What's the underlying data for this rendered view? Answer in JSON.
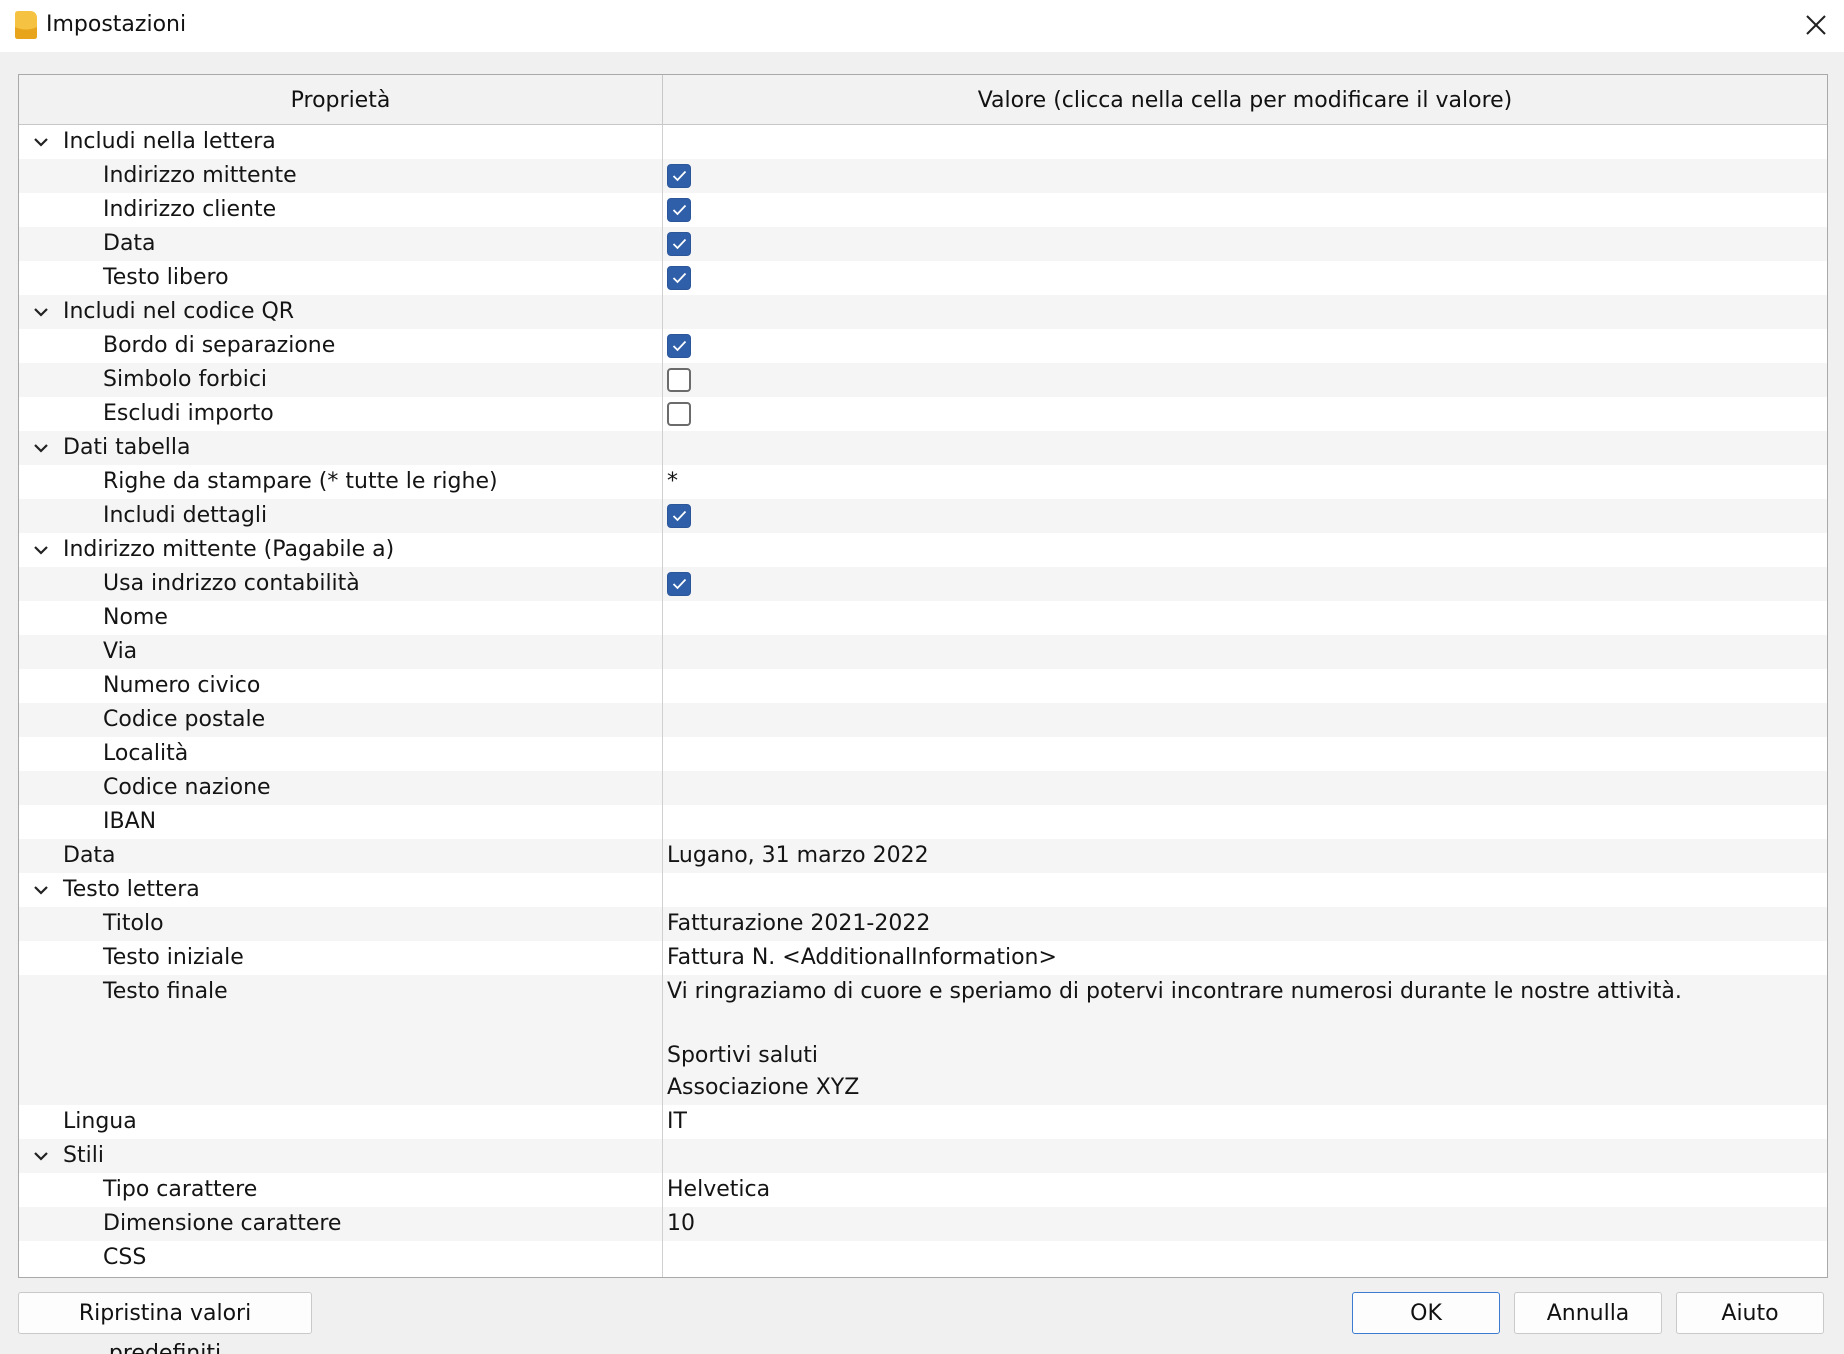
{
  "window": {
    "title": "Impostazioni"
  },
  "table": {
    "headers": {
      "property": "Proprietà",
      "value": "Valore (clicca nella cella per modificare il valore)"
    },
    "rows": [
      {
        "label": "Includi nella lettera",
        "level": 0,
        "group": true
      },
      {
        "label": "Indirizzo mittente",
        "level": 1,
        "checkbox": true,
        "checked": true
      },
      {
        "label": "Indirizzo cliente",
        "level": 1,
        "checkbox": true,
        "checked": true
      },
      {
        "label": "Data",
        "level": 1,
        "checkbox": true,
        "checked": true
      },
      {
        "label": "Testo libero",
        "level": 1,
        "checkbox": true,
        "checked": true
      },
      {
        "label": "Includi nel codice QR",
        "level": 0,
        "group": true
      },
      {
        "label": "Bordo di separazione",
        "level": 1,
        "checkbox": true,
        "checked": true
      },
      {
        "label": "Simbolo forbici",
        "level": 1,
        "checkbox": true,
        "checked": false
      },
      {
        "label": "Escludi importo",
        "level": 1,
        "checkbox": true,
        "checked": false
      },
      {
        "label": "Dati tabella",
        "level": 0,
        "group": true
      },
      {
        "label": "Righe da stampare (* tutte le righe)",
        "level": 1,
        "value": "*"
      },
      {
        "label": "Includi dettagli",
        "level": 1,
        "checkbox": true,
        "checked": true
      },
      {
        "label": "Indirizzo mittente (Pagabile a)",
        "level": 0,
        "group": true
      },
      {
        "label": "Usa indrizzo contabilità",
        "level": 1,
        "checkbox": true,
        "checked": true
      },
      {
        "label": "Nome",
        "level": 1,
        "value": ""
      },
      {
        "label": "Via",
        "level": 1,
        "value": ""
      },
      {
        "label": "Numero civico",
        "level": 1,
        "value": ""
      },
      {
        "label": "Codice postale",
        "level": 1,
        "value": ""
      },
      {
        "label": "Località",
        "level": 1,
        "value": ""
      },
      {
        "label": "Codice nazione",
        "level": 1,
        "value": ""
      },
      {
        "label": "IBAN",
        "level": 1,
        "value": ""
      },
      {
        "label": "Data",
        "level": 0,
        "value": "Lugano, 31 marzo 2022"
      },
      {
        "label": "Testo lettera",
        "level": 0,
        "group": true
      },
      {
        "label": "Titolo",
        "level": 1,
        "value": "Fatturazione 2021-2022"
      },
      {
        "label": "Testo iniziale",
        "level": 1,
        "value": "Fattura N. <AdditionalInformation>"
      },
      {
        "label": "Testo finale",
        "level": 1,
        "multiline": true,
        "lines": [
          "Vi ringraziamo di cuore e speriamo di potervi incontrare numerosi durante le nostre attività.",
          "",
          "Sportivi saluti",
          "Associazione XYZ"
        ]
      },
      {
        "label": "Lingua",
        "level": 0,
        "value": "IT"
      },
      {
        "label": "Stili",
        "level": 0,
        "group": true
      },
      {
        "label": "Tipo carattere",
        "level": 1,
        "value": "Helvetica"
      },
      {
        "label": "Dimensione carattere",
        "level": 1,
        "value": "10"
      },
      {
        "label": "CSS",
        "level": 1,
        "value": ""
      }
    ]
  },
  "buttons": {
    "reset": "Ripristina valori predefiniti",
    "ok": "OK",
    "cancel": "Annulla",
    "help": "Aiuto"
  },
  "colors": {
    "accent": "#2f5fa8",
    "app_icon": "#f5c242",
    "row_alt": "#f5f5f5"
  },
  "icons": {
    "app": "app-logo-icon",
    "close": "close-icon",
    "expand": "chevron-down-icon",
    "check": "checkmark-icon"
  }
}
